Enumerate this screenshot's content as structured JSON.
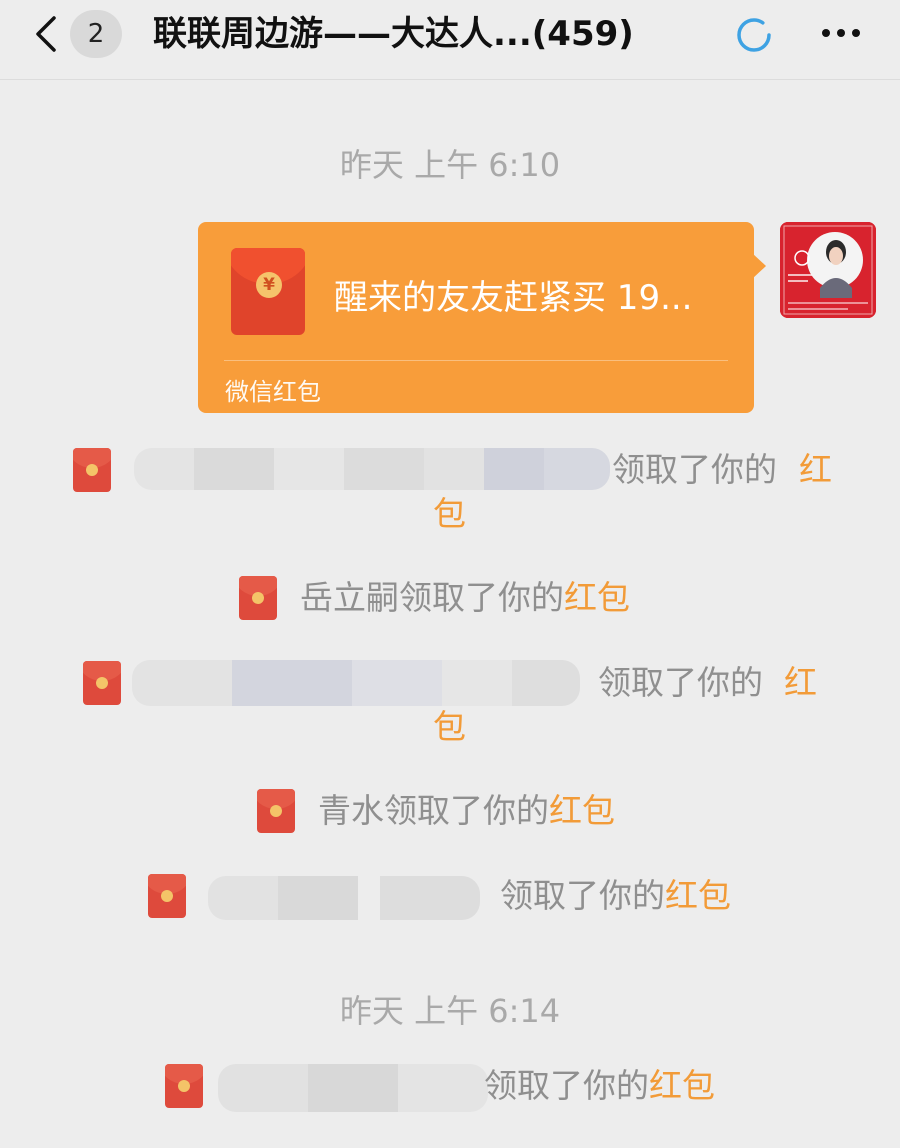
{
  "header": {
    "unread_count": "2",
    "title": "联联周边游——大达人...",
    "member_count": "(459)"
  },
  "chat": {
    "timestamp_1": "昨天 上午 6:10",
    "red_packet": {
      "message": "醒来的友友赶紧买 19...",
      "footer_label": "微信红包",
      "coin_symbol": "¥"
    },
    "timestamp_2": "昨天 上午 6:14",
    "notifications": [
      {
        "name": "",
        "received_text": "领取了你的",
        "packet_text": "红包"
      },
      {
        "name": "岳立嗣",
        "received_text": "领取了你的",
        "packet_text": "红包"
      },
      {
        "name": "",
        "received_text": "领取了你的",
        "packet_text": "红包"
      },
      {
        "name": "青水",
        "received_text": "领取了你的",
        "packet_text": "红包"
      },
      {
        "name": "",
        "received_text": "领取了你的",
        "packet_text": "红包"
      },
      {
        "name": "",
        "received_text": "领取了你的",
        "packet_text": "红包"
      }
    ]
  },
  "colors": {
    "red_packet_bubble": "#f89d3a",
    "red_packet_text": "#f29b38",
    "system_text": "#8f8f8f",
    "background": "#ededed"
  },
  "icons": [
    "back-chevron-icon",
    "loading-spinner-icon",
    "more-dots-icon",
    "red-packet-icon"
  ]
}
